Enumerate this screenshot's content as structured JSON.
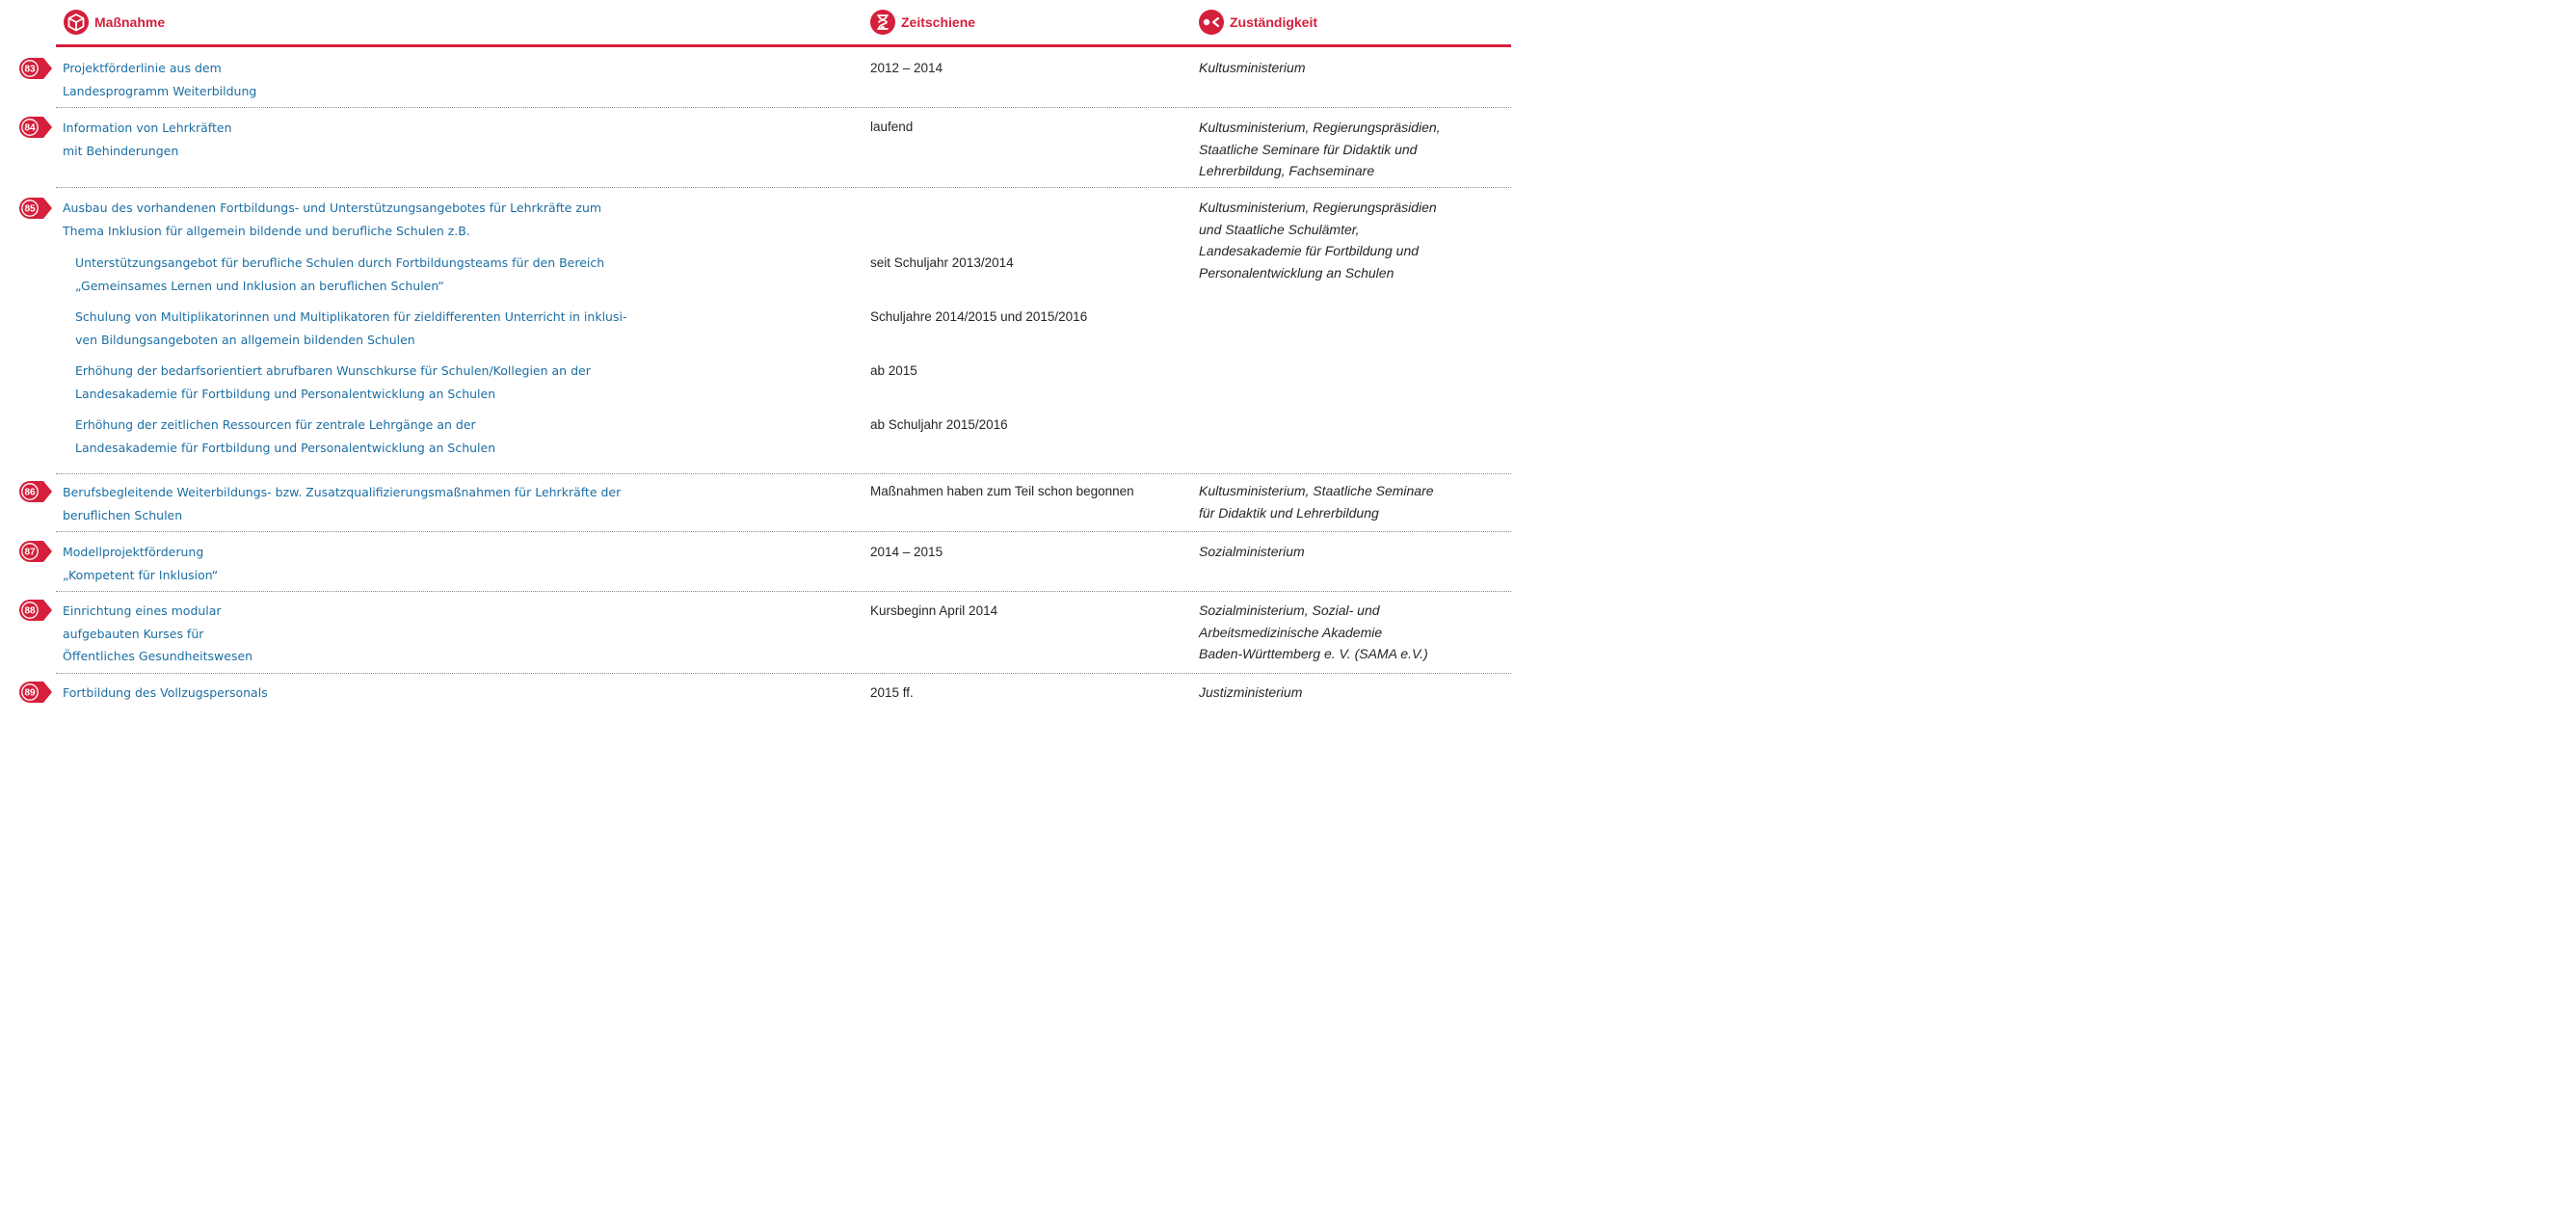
{
  "header": {
    "measure": "Maßnahme",
    "timeline": "Zeitschiene",
    "responsibility": "Zuständigkeit"
  },
  "colors": {
    "accent": "#d51f3b",
    "link_text": "#1b6ea3",
    "body_text": "#23272b"
  },
  "rows": [
    {
      "number": "83",
      "measure_lines": [
        "Projektförderlinie aus dem",
        "Landesprogramm Weiterbildung"
      ],
      "timeline": "2012 – 2014",
      "responsibility_lines": [
        "Kultusministerium"
      ]
    },
    {
      "number": "84",
      "measure_lines": [
        "Information von Lehrkräften",
        "mit Behinderungen"
      ],
      "timeline": "laufend",
      "responsibility_lines": [
        "Kultusministerium, Regierungspräsidien,",
        "Staatliche Seminare für Didaktik und",
        "Lehrerbildung, Fachseminare"
      ]
    },
    {
      "number": "85",
      "measure_lines": [
        "Ausbau des vorhandenen Fortbildungs- und Unterstützungsangebotes für Lehrkräfte zum",
        "Thema Inklusion für allgemein bildende und berufliche Schulen z.B."
      ],
      "timeline": "",
      "responsibility_lines": [
        "Kultusministerium, Regierungspräsidien",
        "und Staatliche Schulämter,",
        "Landesakademie für Fortbildung und",
        "Personalentwicklung an Schulen"
      ],
      "subitems": [
        {
          "lines": [
            "Unterstützungsangebot für berufliche Schulen durch Fortbildungsteams für den Bereich",
            "„Gemeinsames Lernen und Inklusion an beruflichen Schulen“"
          ],
          "timeline": "seit Schuljahr 2013/2014"
        },
        {
          "lines": [
            "Schulung von Multiplikatorinnen und Multiplikatoren für zieldifferenten Unterricht in inklusi-",
            "ven Bildungsangeboten an allgemein bildenden Schulen"
          ],
          "timeline": "Schuljahre 2014/2015 und 2015/2016"
        },
        {
          "lines": [
            "Erhöhung der bedarfsorientiert abrufbaren Wunschkurse für Schulen/Kollegien an der",
            "Landesakademie für Fortbildung und Personalentwicklung an Schulen"
          ],
          "timeline": "ab 2015"
        },
        {
          "lines": [
            "Erhöhung der zeitlichen Ressourcen für zentrale Lehrgänge an der",
            "Landesakademie für Fortbildung und Personalentwicklung an Schulen"
          ],
          "timeline": "ab Schuljahr 2015/2016"
        }
      ]
    },
    {
      "number": "86",
      "measure_lines": [
        "Berufsbegleitende Weiterbildungs- bzw. Zusatzqualifizierungsmaßnahmen für Lehrkräfte der",
        "beruflichen Schulen"
      ],
      "timeline": "Maßnahmen haben zum Teil schon begonnen",
      "responsibility_lines": [
        "Kultusministerium, Staatliche Seminare",
        "für Didaktik und Lehrerbildung"
      ]
    },
    {
      "number": "87",
      "measure_lines": [
        "Modellprojektförderung",
        "„Kompetent für Inklusion“"
      ],
      "timeline": "2014 – 2015",
      "responsibility_lines": [
        "Sozialministerium"
      ]
    },
    {
      "number": "88",
      "measure_lines": [
        "Einrichtung eines modular",
        "aufgebauten Kurses für",
        "Öffentliches Gesundheitswesen"
      ],
      "timeline": "Kursbeginn April 2014",
      "responsibility_lines": [
        "Sozialministerium, Sozial- und",
        "Arbeitsmedizinische Akademie",
        "Baden-Württemberg e. V. (SAMA e.V.)"
      ]
    },
    {
      "number": "89",
      "measure_lines": [
        "Fortbildung des Vollzugspersonals"
      ],
      "timeline": "2015 ff.",
      "responsibility_lines": [
        "Justizministerium"
      ]
    }
  ]
}
